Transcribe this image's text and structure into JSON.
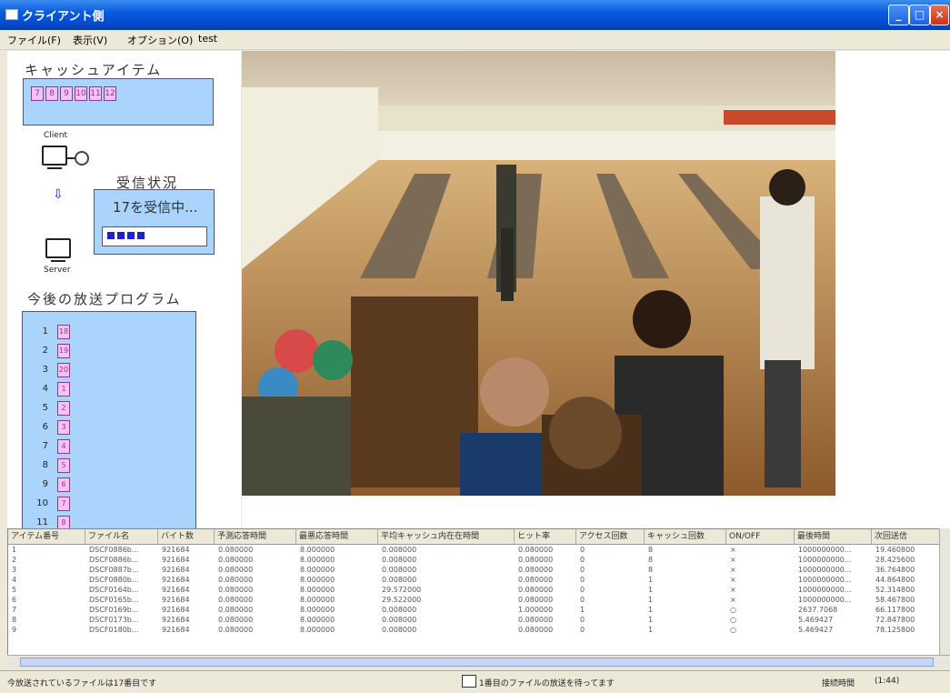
{
  "window": {
    "title": "クライアント側"
  },
  "menu": [
    "ファイル(F)",
    "表示(V)",
    "オプション(O)",
    "test"
  ],
  "left": {
    "cache_title": "キャッシュアイテム",
    "cache_items": [
      "7",
      "8",
      "9",
      "10",
      "11",
      "12"
    ],
    "client_label": "Client",
    "server_label": "Server",
    "status_title": "受信状況",
    "status_message": "17を受信中...",
    "progress_blocks": 4,
    "program_title": "今後の放送プログラム",
    "program_rows": [
      {
        "n": "1",
        "v": "18"
      },
      {
        "n": "2",
        "v": "19"
      },
      {
        "n": "3",
        "v": "20"
      },
      {
        "n": "4",
        "v": "1"
      },
      {
        "n": "5",
        "v": "2"
      },
      {
        "n": "6",
        "v": "3"
      },
      {
        "n": "7",
        "v": "4"
      },
      {
        "n": "8",
        "v": "5"
      },
      {
        "n": "9",
        "v": "6"
      },
      {
        "n": "10",
        "v": "7"
      },
      {
        "n": "11",
        "v": "8"
      }
    ]
  },
  "table": {
    "headers": [
      "アイテム番号",
      "ファイル名",
      "バイト数",
      "予測応答時間",
      "最悪応答時間",
      "平均キャッシュ内在在時間",
      "ヒット率",
      "アクセス回数",
      "キャッシュ回数",
      "ON/OFF",
      "最後時間",
      "次回送信"
    ],
    "rows": [
      [
        "1",
        "DSCF0886b...",
        "921684",
        "0.080000",
        "8.000000",
        "0.008000",
        "0.080000",
        "0",
        "8",
        "×",
        "1000000000...",
        "19.460800"
      ],
      [
        "2",
        "DSCF0886b...",
        "921684",
        "0.080000",
        "8.000000",
        "0.008000",
        "0.080000",
        "0",
        "8",
        "×",
        "1000000000...",
        "28.425600"
      ],
      [
        "3",
        "DSCF0887b...",
        "921684",
        "0.080000",
        "8.000000",
        "0.008000",
        "0.080000",
        "0",
        "8",
        "×",
        "1000000000...",
        "36.764800"
      ],
      [
        "4",
        "DSCF0880b...",
        "921684",
        "0.080000",
        "8.000000",
        "0.008000",
        "0.080000",
        "0",
        "1",
        "×",
        "1000000000...",
        "44.864800"
      ],
      [
        "5",
        "DSCF0164b...",
        "921684",
        "0.080000",
        "8.000000",
        "29.572000",
        "0.080000",
        "0",
        "1",
        "×",
        "1000000000...",
        "52.314800"
      ],
      [
        "6",
        "DSCF0165b...",
        "921684",
        "0.080000",
        "8.000000",
        "29.522000",
        "0.080000",
        "0",
        "1",
        "×",
        "1000000000...",
        "58.467800"
      ],
      [
        "7",
        "DSCF0169b...",
        "921684",
        "0.080000",
        "8.000000",
        "0.008000",
        "1.000000",
        "1",
        "1",
        "○",
        "2637.7068",
        "66.117800"
      ],
      [
        "8",
        "DSCF0173b...",
        "921684",
        "0.080000",
        "8.000000",
        "0.008000",
        "0.080000",
        "0",
        "1",
        "○",
        "5.469427",
        "72.847800"
      ],
      [
        "9",
        "DSCF0180b...",
        "921684",
        "0.080000",
        "8.000000",
        "0.008000",
        "0.080000",
        "0",
        "1",
        "○",
        "5.469427",
        "78.125800"
      ]
    ]
  },
  "status": {
    "left": "今放送されているファイルは17番目です",
    "center": "1番目のファイルの放送を待ってます",
    "right_label": "接続時間",
    "right_value": "(1:44)"
  }
}
